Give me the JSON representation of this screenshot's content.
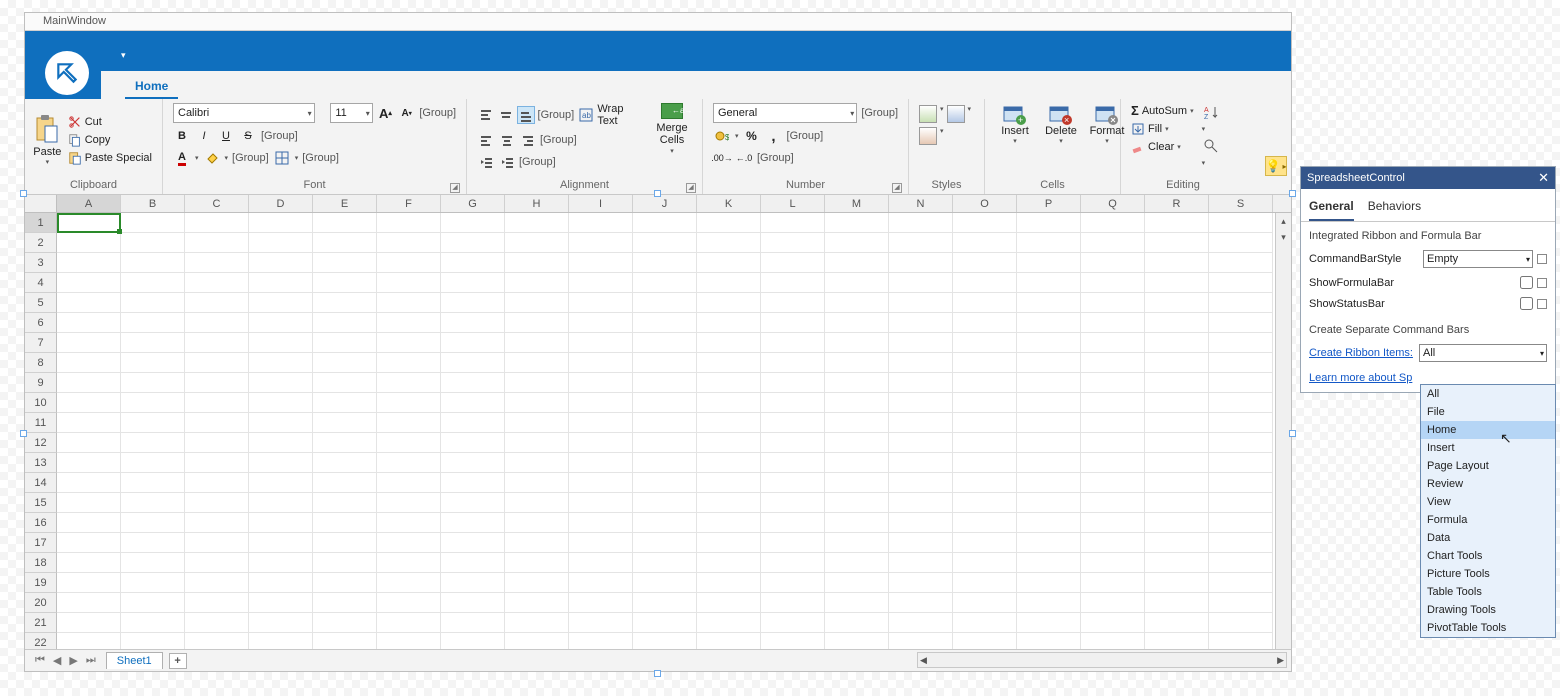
{
  "window": {
    "title": "MainWindow"
  },
  "ribbon": {
    "tabs": {
      "home": "Home"
    },
    "groups": {
      "clipboard": {
        "label": "Clipboard",
        "paste": "Paste",
        "cut": "Cut",
        "copy": "Copy",
        "paste_special": "Paste Special"
      },
      "font": {
        "label": "Font",
        "name": "Calibri",
        "size": "11",
        "group_tag": "[Group]"
      },
      "alignment": {
        "label": "Alignment",
        "wrap": "Wrap Text",
        "merge": "Merge\nCells",
        "group_tag": "[Group]"
      },
      "number": {
        "label": "Number",
        "format": "General",
        "group_tag": "[Group]"
      },
      "styles": {
        "label": "Styles"
      },
      "cells": {
        "label": "Cells",
        "insert": "Insert",
        "delete": "Delete",
        "format": "Format"
      },
      "editing": {
        "label": "Editing",
        "autosum": "AutoSum",
        "fill": "Fill",
        "clear": "Clear"
      }
    }
  },
  "grid": {
    "cols": [
      "A",
      "B",
      "C",
      "D",
      "E",
      "F",
      "G",
      "H",
      "I",
      "J",
      "K",
      "L",
      "M",
      "N",
      "O",
      "P",
      "Q",
      "R",
      "S"
    ],
    "rows": 22
  },
  "sheet": {
    "name": "Sheet1"
  },
  "panel": {
    "title": "SpreadsheetControl",
    "tabs": {
      "general": "General",
      "behaviors": "Behaviors"
    },
    "section1": "Integrated Ribbon and Formula Bar",
    "cmdbar_label": "CommandBarStyle",
    "cmdbar_value": "Empty",
    "show_formula": "ShowFormulaBar",
    "show_status": "ShowStatusBar",
    "section2": "Create Separate Command Bars",
    "create_ribbon": "Create Ribbon Items:",
    "create_ribbon_value": "All",
    "learn": "Learn more about Sp"
  },
  "dropdown": {
    "items": [
      "All",
      "File",
      "Home",
      "Insert",
      "Page Layout",
      "Review",
      "View",
      "Formula",
      "Data",
      "Chart Tools",
      "Picture Tools",
      "Table Tools",
      "Drawing Tools",
      "PivotTable Tools"
    ],
    "highlight": "Home"
  }
}
